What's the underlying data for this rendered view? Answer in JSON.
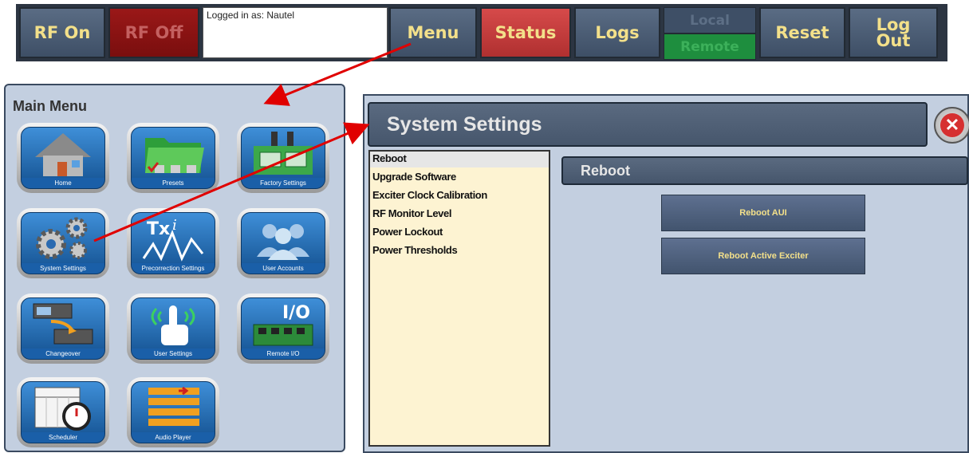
{
  "toolbar": {
    "rf_on": "RF On",
    "rf_off": "RF Off",
    "login_text": "Logged in as: Nautel",
    "menu": "Menu",
    "status": "Status",
    "logs": "Logs",
    "local": "Local",
    "remote": "Remote",
    "reset": "Reset",
    "logout_line1": "Log",
    "logout_line2": "Out"
  },
  "main_menu": {
    "title": "Main Menu",
    "tiles": [
      {
        "label": "Home",
        "icon": "home-icon"
      },
      {
        "label": "Presets",
        "icon": "folder-icon"
      },
      {
        "label": "Factory Settings",
        "icon": "factory-icon"
      },
      {
        "label": "System Settings",
        "icon": "gears-icon"
      },
      {
        "label": "Precorrection Settings",
        "icon": "txi-waveform-icon"
      },
      {
        "label": "User Accounts",
        "icon": "users-icon"
      },
      {
        "label": "Changeover",
        "icon": "changeover-icon"
      },
      {
        "label": "User Settings",
        "icon": "touch-hand-icon"
      },
      {
        "label": "Remote I/O",
        "icon": "io-board-icon"
      },
      {
        "label": "Scheduler",
        "icon": "calendar-clock-icon"
      },
      {
        "label": "Audio Player",
        "icon": "playlist-icon"
      }
    ]
  },
  "system_settings": {
    "title": "System Settings",
    "close_icon": "close-icon",
    "list": [
      "Reboot",
      "Upgrade Software",
      "Exciter Clock Calibration",
      "RF Monitor Level",
      "Power Lockout",
      "Power Thresholds"
    ],
    "selected": "Reboot",
    "section_title": "Reboot",
    "buttons": [
      "Reboot AUI",
      "Reboot Active Exciter"
    ]
  },
  "colors": {
    "toolbar_bg": "#2c3542",
    "button_text": "#f3e08a",
    "status_red": "#d64a4a",
    "remote_green": "#1e8e3e",
    "panel_bg": "#c3cfe0",
    "list_bg": "#fdf3d2",
    "arrow_red": "#e00000"
  }
}
